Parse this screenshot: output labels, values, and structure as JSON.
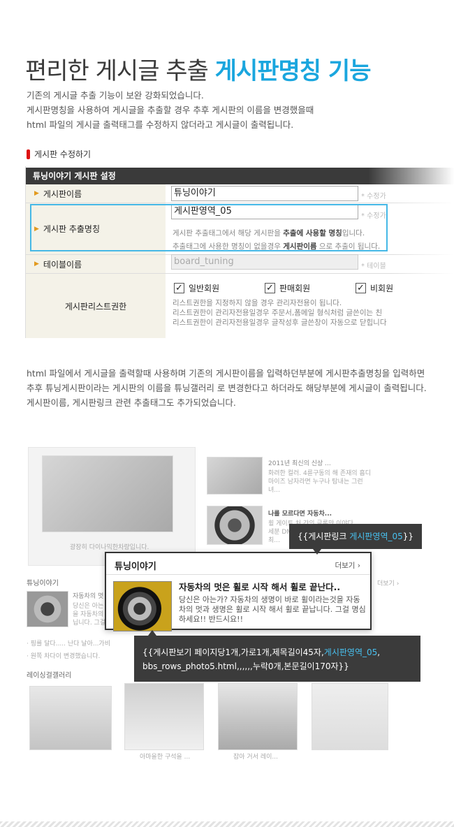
{
  "header": {
    "title_plain": "편리한 게시글 추출 ",
    "title_highlight": "게시판명칭 기능",
    "intro": [
      "기존의 게시글 추출 기능이 보완 강화되었습니다.",
      "게시판명칭을 사용하여 게시글을 추출할 경우 추후 게시판의 이름을 변경했을때",
      "html 파일의 게시글 출력태그를 수정하지 않더라고 게시글이 출력됩니다."
    ]
  },
  "section_label": "게시판 수정하기",
  "panel": {
    "heading": "튜닝이야기 게시판 설정",
    "rows": {
      "name": {
        "label": "게시판이름",
        "value": "튜닝이야기",
        "note": "* 수정가"
      },
      "extract": {
        "label": "게시판 추출명칭",
        "value": "게시판영역_05",
        "note": "* 수정가",
        "help1_a": "게시판 추출태그에서 해당 게시판을 ",
        "help1_b": "추출에 사용할 명칭",
        "help1_c": "입니다.",
        "help2_a": "추출태그에 사용한 명칭이 없을경우 ",
        "help2_b": "게시판이름",
        "help2_c": " 으로 추출이 됩니다."
      },
      "table": {
        "label": "테이블이름",
        "value": "board_tuning",
        "note": "* 테이블"
      },
      "perm": {
        "label": "게시판리스트권한",
        "checks": [
          "일반회원",
          "판매회원",
          "비회원"
        ],
        "check_mark": "✓",
        "help": [
          "리스트권한을 지정하지 않을 경우 관리자전용이 됩니다.",
          "리스트권한이 관리자전용일경우 주문서,폼메일 형식처럼 글쓴이는 친",
          "리스트권한이 관리자전용일경우 글작성후 글쓴창이 자동으로 닫힙니다"
        ]
      }
    }
  },
  "paragraph": [
    "html 파일에서 게시글을 출력할때 사용하며 기존의 게시판이름을 입력하던부분에 게시판추출명칭을 입력하면",
    "추후 튜닝게시판이라는 게시판의 이름을 튜닝갤러리 로 변경한다고 하더라도 해당부분에 게시글이 출력됩니다.",
    "게시판이름, 게시판링크 관련 추출태그도 추가되었습니다."
  ],
  "illustration": {
    "ghost": {
      "main_caption": "광장히 다이나믹한차량입니다.",
      "news1_title": "2011년 최신의 신상 ...",
      "news1_body": [
        "화려한 컬러. 4륜구동의 해 존재의 흡디",
        "마이즈 남자라면 누구나 탐내는 그런",
        "녀..."
      ],
      "news2_title": "나를 모르다면 자동차...",
      "news2_body": [
        "휠 게이트 처 간의 글록만 이야다",
        "세분 DM",
        "최..."
      ],
      "tuning_label": "튜닝이야기",
      "tuning_item": "자동차의 멋",
      "tuning_lines": [
        "당신은 아는",
        "을 자동차의",
        "닙니다. 그걸"
      ],
      "more_right": "더보기 ›",
      "list1": "· 핑를 달다..... 난다 날아...가비",
      "list2": "· 원쪽 차다이 변경했습니다.",
      "racing_label": "레이싱걸갤러리",
      "gallery_caption1": "아마을한 구석을 ...",
      "gallery_caption2": "잡아 거서 레이..."
    },
    "board_card": {
      "title": "튜닝이야기",
      "more": "더보기 ›",
      "post_title": "자동차의 멋은 휠로 시작 해서 휠로 끝난다..",
      "post_body": "당신은 아는가? 자동차의 생명이 바로 휠이라는것을 자동차의 멋과 생명은 휠로 시작 해서 휠로 끝납니다. 그걸 명심하세요!! 반드시요!!"
    },
    "tooltip_link": {
      "prefix": "{{게시판링크 ",
      "highlight": "게시판영역_05",
      "suffix": "}}"
    },
    "tooltip_board": {
      "prefix": "{{게시판보기 페이지당1개,가로1개,제목길이45자,",
      "highlight": "게시판영역_05",
      "suffix": ", bbs_rows_photo5.html,,,,,,누락0개,본문길이170자}}"
    }
  }
}
